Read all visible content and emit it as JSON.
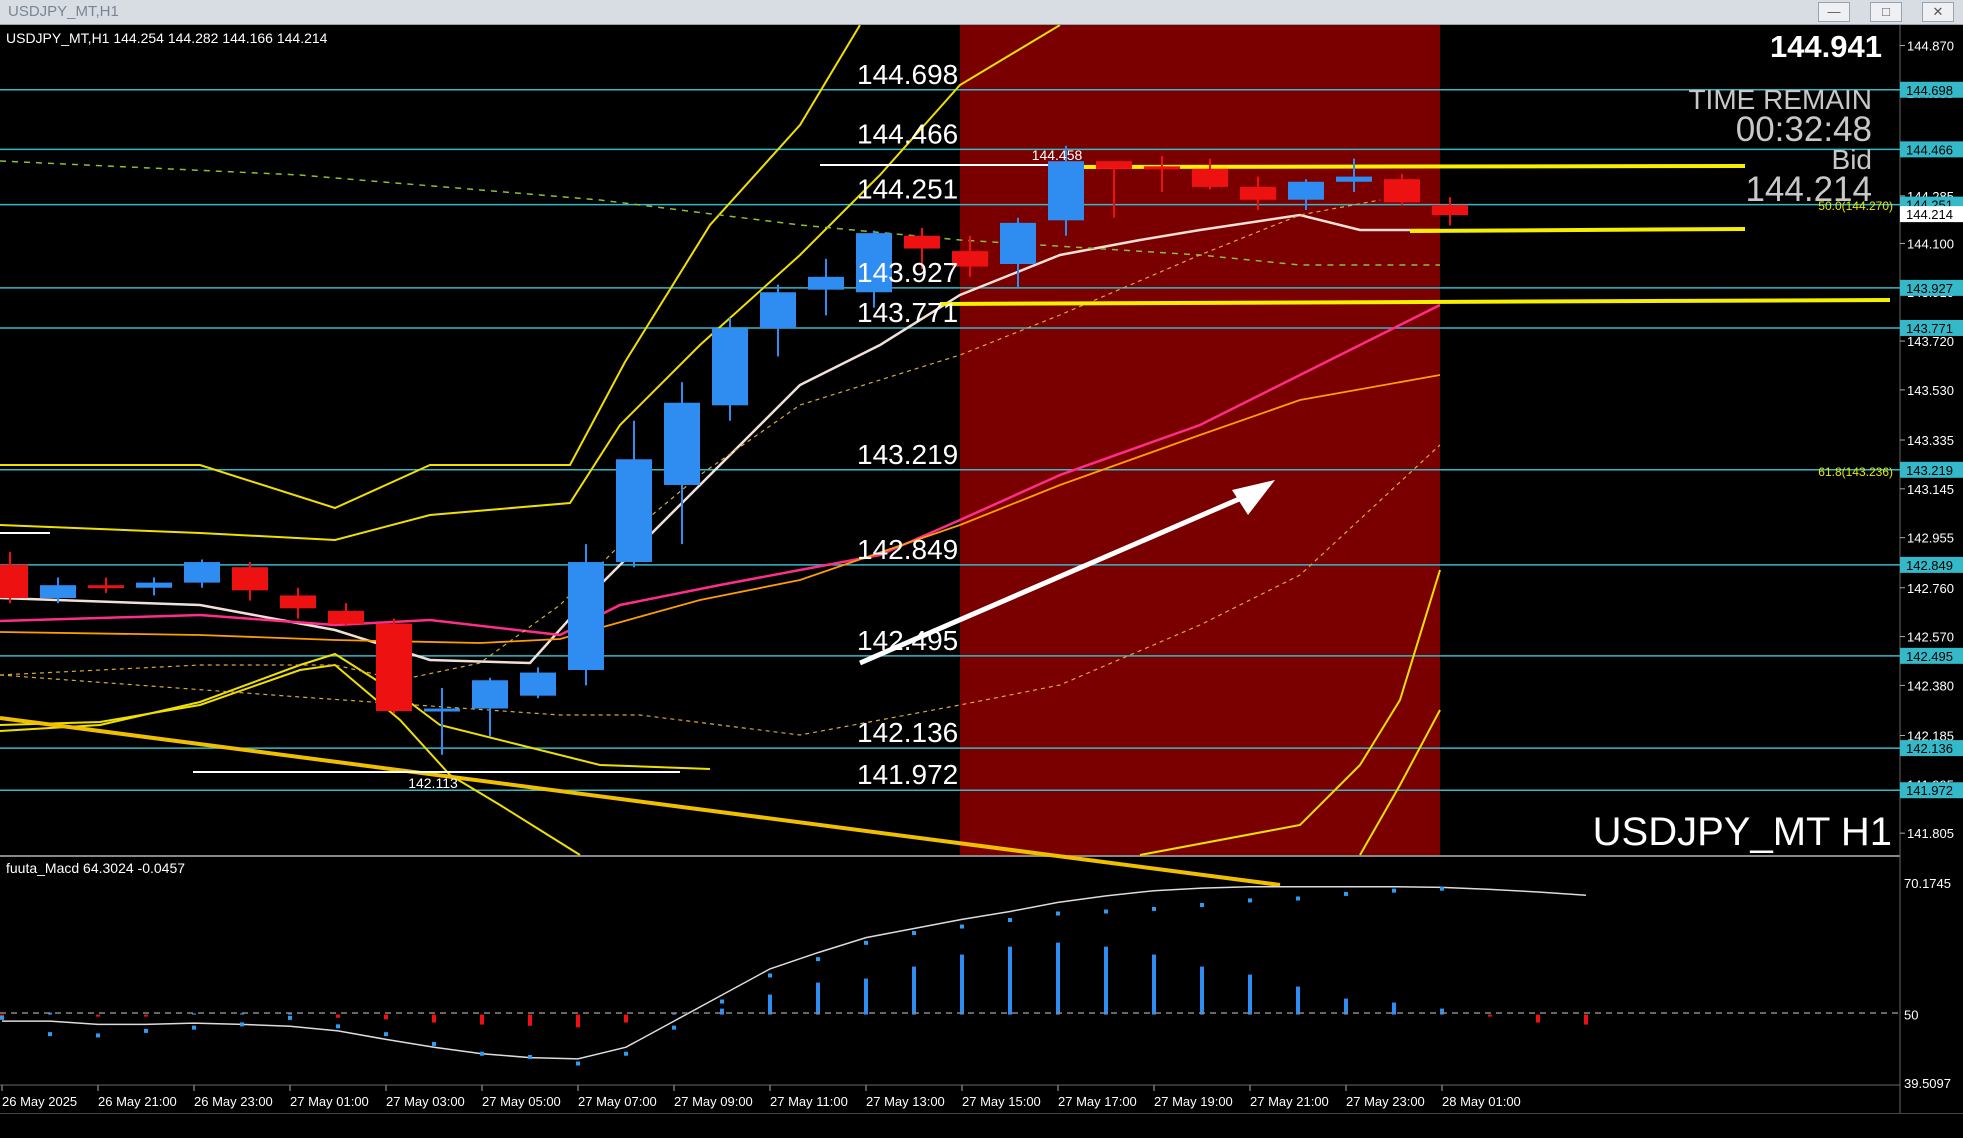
{
  "window": {
    "title": "USDJPY_MT,H1",
    "buttons": [
      "minimize",
      "maximize",
      "close"
    ]
  },
  "chart_data": [
    {
      "type": "candlestick",
      "symbol": "USDJPY_MT",
      "timeframe": "H1",
      "info_line": "USDJPY_MT,H1  144.254 144.282 144.166 144.214",
      "watermark": "USDJPY_MT H1",
      "current_price_label": "144.941",
      "time_remain_label": "TIME REMAIN",
      "time_remain_value": "00:32:48",
      "bid_label": "Bid",
      "bid_value": "144.214",
      "ylim": [
        141.72,
        144.95
      ],
      "yticks": [
        "144.870",
        "144.685",
        "144.285",
        "144.100",
        "143.910",
        "143.720",
        "143.530",
        "143.335",
        "143.145",
        "142.955",
        "142.760",
        "142.570",
        "142.380",
        "142.185",
        "141.995",
        "141.805"
      ],
      "x_labels": [
        "26 May 2025",
        "26 May 21:00",
        "26 May 23:00",
        "27 May 01:00",
        "27 May 03:00",
        "27 May 05:00",
        "27 May 07:00",
        "27 May 09:00",
        "27 May 11:00",
        "27 May 13:00",
        "27 May 15:00",
        "27 May 17:00",
        "27 May 19:00",
        "27 May 21:00",
        "27 May 23:00",
        "28 May 01:00"
      ],
      "horizontal_levels": [
        144.698,
        144.466,
        144.251,
        143.927,
        143.771,
        143.219,
        142.849,
        142.495,
        142.136,
        141.972
      ],
      "level_labels": [
        "144.698",
        "144.466",
        "144.251",
        "143.927",
        "143.771",
        "143.219",
        "142.849",
        "142.495",
        "142.136",
        "141.972"
      ],
      "price_tags": [
        "144.698",
        "144.466",
        "144.251",
        "144.214",
        "143.927",
        "143.771",
        "143.219",
        "142.849",
        "142.495",
        "142.136",
        "141.972"
      ],
      "fib_labels": [
        "50.0(144.270)",
        "61.8(143.236)"
      ],
      "annotations": {
        "swing_high": "144.458",
        "swing_low": "142.113"
      },
      "candles": [
        {
          "o": 142.85,
          "h": 142.9,
          "l": 142.7,
          "c": 142.72
        },
        {
          "o": 142.72,
          "h": 142.8,
          "l": 142.7,
          "c": 142.77
        },
        {
          "o": 142.77,
          "h": 142.8,
          "l": 142.74,
          "c": 142.76
        },
        {
          "o": 142.76,
          "h": 142.8,
          "l": 142.73,
          "c": 142.78
        },
        {
          "o": 142.78,
          "h": 142.87,
          "l": 142.76,
          "c": 142.86
        },
        {
          "o": 142.84,
          "h": 142.86,
          "l": 142.71,
          "c": 142.75
        },
        {
          "o": 142.73,
          "h": 142.76,
          "l": 142.64,
          "c": 142.68
        },
        {
          "o": 142.67,
          "h": 142.7,
          "l": 142.61,
          "c": 142.62
        },
        {
          "o": 142.62,
          "h": 142.64,
          "l": 142.27,
          "c": 142.28
        },
        {
          "o": 142.28,
          "h": 142.37,
          "l": 142.11,
          "c": 142.29
        },
        {
          "o": 142.29,
          "h": 142.41,
          "l": 142.18,
          "c": 142.4
        },
        {
          "o": 142.34,
          "h": 142.45,
          "l": 142.33,
          "c": 142.43
        },
        {
          "o": 142.44,
          "h": 142.93,
          "l": 142.38,
          "c": 142.86
        },
        {
          "o": 142.86,
          "h": 143.41,
          "l": 142.84,
          "c": 143.26
        },
        {
          "o": 143.16,
          "h": 143.56,
          "l": 142.93,
          "c": 143.48
        },
        {
          "o": 143.47,
          "h": 143.81,
          "l": 143.41,
          "c": 143.77
        },
        {
          "o": 143.77,
          "h": 143.94,
          "l": 143.66,
          "c": 143.91
        },
        {
          "o": 143.92,
          "h": 144.04,
          "l": 143.82,
          "c": 143.97
        },
        {
          "o": 143.91,
          "h": 144.15,
          "l": 143.85,
          "c": 144.14
        },
        {
          "o": 144.13,
          "h": 144.16,
          "l": 144.0,
          "c": 144.08
        },
        {
          "o": 144.07,
          "h": 144.13,
          "l": 143.97,
          "c": 144.01
        },
        {
          "o": 144.02,
          "h": 144.2,
          "l": 143.93,
          "c": 144.18
        },
        {
          "o": 144.19,
          "h": 144.48,
          "l": 144.13,
          "c": 144.42
        },
        {
          "o": 144.42,
          "h": 144.42,
          "l": 144.2,
          "c": 144.39
        },
        {
          "o": 144.4,
          "h": 144.44,
          "l": 144.3,
          "c": 144.39
        },
        {
          "o": 144.39,
          "h": 144.43,
          "l": 144.31,
          "c": 144.32
        },
        {
          "o": 144.32,
          "h": 144.36,
          "l": 144.23,
          "c": 144.27
        },
        {
          "o": 144.27,
          "h": 144.35,
          "l": 144.23,
          "c": 144.34
        },
        {
          "o": 144.34,
          "h": 144.43,
          "l": 144.3,
          "c": 144.36
        },
        {
          "o": 144.35,
          "h": 144.37,
          "l": 144.25,
          "c": 144.26
        },
        {
          "o": 144.25,
          "h": 144.28,
          "l": 144.17,
          "c": 144.21
        }
      ]
    },
    {
      "type": "bar",
      "name": "fuuta_Macd",
      "info_line": "fuuta_Macd 64.3024  -0.0457",
      "ylim": [
        39.5097,
        70.1745
      ],
      "yticks": [
        "70.1745",
        "50",
        "39.5097"
      ],
      "histogram": [
        -1,
        0.5,
        -0.5,
        -0.5,
        0.3,
        0.3,
        0.3,
        -0.8,
        -1.2,
        -2,
        -2.5,
        -2.8,
        -3.2,
        -2,
        0.5,
        1.5,
        5,
        8,
        9,
        12,
        15,
        17,
        18,
        17,
        15,
        12,
        10,
        7,
        4,
        3,
        1.5,
        -0.5,
        -2,
        -2.5
      ],
      "signal": [
        49,
        49,
        48.5,
        48.5,
        48.7,
        48.5,
        48.2,
        47.5,
        46.2,
        45,
        44,
        43.4,
        43.2,
        45,
        49,
        53,
        57,
        59.5,
        61.8,
        63.2,
        64.6,
        65.8,
        67.2,
        68.2,
        69,
        69.4,
        69.6,
        69.6,
        69.6,
        69.6,
        69.5,
        69.2,
        68.8,
        68.3
      ],
      "macd_dots": [
        49.5,
        47,
        46.8,
        47.5,
        48,
        48.5,
        49.5,
        48.2,
        47,
        45.5,
        44,
        43.5,
        42.5,
        44,
        48,
        52,
        56,
        58.5,
        61,
        62.5,
        63.5,
        64.5,
        65.5,
        65.8,
        66.2,
        66.8,
        67.5,
        67.8,
        68.5,
        69,
        69.3
      ]
    }
  ]
}
